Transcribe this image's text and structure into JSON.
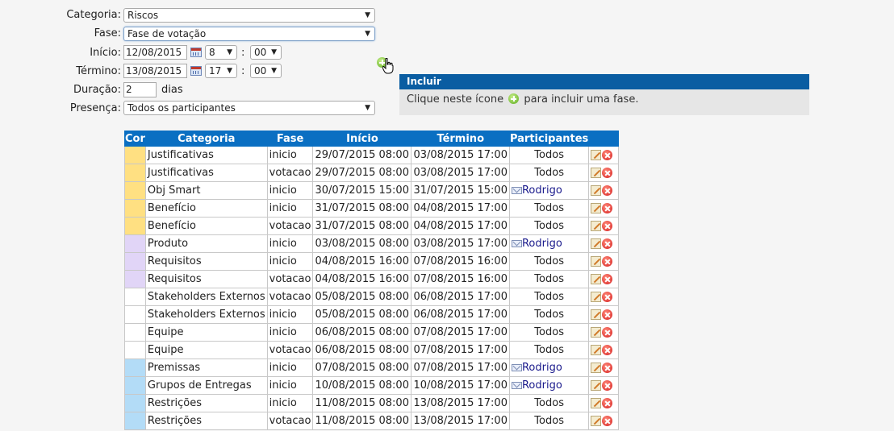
{
  "form": {
    "categoria_label": "Categoria:",
    "categoria_value": "Riscos",
    "fase_label": "Fase:",
    "fase_value": "Fase de votação",
    "inicio_label": "Início:",
    "inicio_date": "12/08/2015",
    "inicio_hour": "8",
    "inicio_min": "00",
    "termino_label": "Término:",
    "termino_date": "13/08/2015",
    "termino_hour": "17",
    "termino_min": "00",
    "colon": ":",
    "duracao_label": "Duração:",
    "duracao_value": "2",
    "duracao_unit": "dias",
    "presenca_label": "Presença:",
    "presenca_value": "Todos os participantes"
  },
  "tooltip": {
    "title": "Incluir",
    "text_before": "Clique neste ícone",
    "text_after": "para incluir uma fase."
  },
  "table": {
    "headers": [
      "Cor",
      "Categoria",
      "Fase",
      "Início",
      "Término",
      "Participantes"
    ],
    "rows": [
      {
        "color": "#ffe082",
        "categoria": "Justificativas",
        "fase": "inicio",
        "inicio": "29/07/2015 08:00",
        "termino": "03/08/2015 17:00",
        "participantes": "Todos",
        "mail": false
      },
      {
        "color": "#ffe082",
        "categoria": "Justificativas",
        "fase": "votacao",
        "inicio": "29/07/2015 08:00",
        "termino": "03/08/2015 17:00",
        "participantes": "Todos",
        "mail": false
      },
      {
        "color": "#ffe082",
        "categoria": "Obj Smart",
        "fase": "inicio",
        "inicio": "30/07/2015 15:00",
        "termino": "31/07/2015 15:00",
        "participantes": "Rodrigo",
        "mail": true
      },
      {
        "color": "#ffe082",
        "categoria": "Benefício",
        "fase": "inicio",
        "inicio": "31/07/2015 08:00",
        "termino": "04/08/2015 17:00",
        "participantes": "Todos",
        "mail": false
      },
      {
        "color": "#ffe082",
        "categoria": "Benefício",
        "fase": "votacao",
        "inicio": "31/07/2015 08:00",
        "termino": "04/08/2015 17:00",
        "participantes": "Todos",
        "mail": false
      },
      {
        "color": "#e1d5f7",
        "categoria": "Produto",
        "fase": "inicio",
        "inicio": "03/08/2015 08:00",
        "termino": "03/08/2015 17:00",
        "participantes": "Rodrigo",
        "mail": true
      },
      {
        "color": "#e1d5f7",
        "categoria": "Requisitos",
        "fase": "inicio",
        "inicio": "04/08/2015 16:00",
        "termino": "07/08/2015 16:00",
        "participantes": "Todos",
        "mail": false
      },
      {
        "color": "#e1d5f7",
        "categoria": "Requisitos",
        "fase": "votacao",
        "inicio": "04/08/2015 16:00",
        "termino": "07/08/2015 16:00",
        "participantes": "Todos",
        "mail": false
      },
      {
        "color": "#ffffff",
        "categoria": "Stakeholders Externos",
        "fase": "votacao",
        "inicio": "05/08/2015 08:00",
        "termino": "06/08/2015 17:00",
        "participantes": "Todos",
        "mail": false
      },
      {
        "color": "#ffffff",
        "categoria": "Stakeholders Externos",
        "fase": "inicio",
        "inicio": "05/08/2015 08:00",
        "termino": "06/08/2015 17:00",
        "participantes": "Todos",
        "mail": false
      },
      {
        "color": "#ffffff",
        "categoria": "Equipe",
        "fase": "inicio",
        "inicio": "06/08/2015 08:00",
        "termino": "07/08/2015 17:00",
        "participantes": "Todos",
        "mail": false
      },
      {
        "color": "#ffffff",
        "categoria": "Equipe",
        "fase": "votacao",
        "inicio": "06/08/2015 08:00",
        "termino": "07/08/2015 17:00",
        "participantes": "Todos",
        "mail": false
      },
      {
        "color": "#b3dcf7",
        "categoria": "Premissas",
        "fase": "inicio",
        "inicio": "07/08/2015 08:00",
        "termino": "07/08/2015 17:00",
        "participantes": "Rodrigo",
        "mail": true
      },
      {
        "color": "#b3dcf7",
        "categoria": "Grupos de Entregas",
        "fase": "inicio",
        "inicio": "10/08/2015 08:00",
        "termino": "10/08/2015 17:00",
        "participantes": "Rodrigo",
        "mail": true
      },
      {
        "color": "#b3dcf7",
        "categoria": "Restrições",
        "fase": "inicio",
        "inicio": "11/08/2015 08:00",
        "termino": "13/08/2015 17:00",
        "participantes": "Todos",
        "mail": false
      },
      {
        "color": "#b3dcf7",
        "categoria": "Restrições",
        "fase": "votacao",
        "inicio": "11/08/2015 08:00",
        "termino": "13/08/2015 17:00",
        "participantes": "Todos",
        "mail": false
      }
    ]
  },
  "icons": {
    "add": "plus-circle-icon",
    "calendar": "calendar-icon",
    "edit": "edit-icon",
    "delete": "delete-icon",
    "mail": "mail-icon",
    "cursor": "hand-cursor-icon"
  },
  "colors": {
    "header_blue": "#0a6fc2",
    "tooltip_blue": "#0a5da2"
  }
}
